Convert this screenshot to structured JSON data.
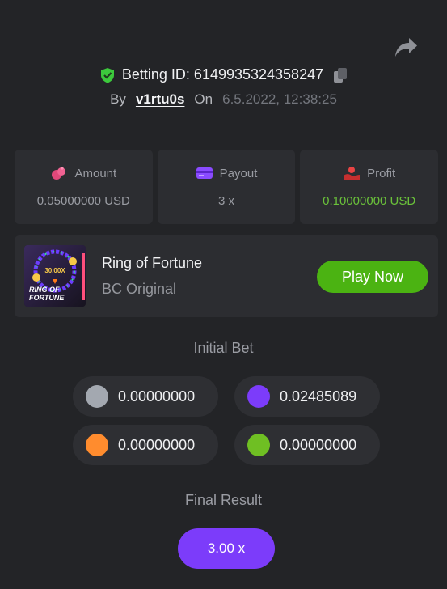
{
  "header": {
    "betting_id_label": "Betting ID: 6149935324358247",
    "by_label": "By",
    "username": "v1rtu0s",
    "on_label": "On",
    "date": "6.5.2022, 12:38:25"
  },
  "stats": {
    "amount": {
      "label": "Amount",
      "value": "0.05000000 USD"
    },
    "payout": {
      "label": "Payout",
      "value": "3 x"
    },
    "profit": {
      "label": "Profit",
      "value": "0.10000000 USD"
    }
  },
  "game": {
    "name": "Ring of Fortune",
    "subtitle": "BC Original",
    "play_label": "Play Now",
    "thumb_multiplier": "30.00X",
    "thumb_logo_line1": "RING OF",
    "thumb_logo_line2": "FORTUNE"
  },
  "initial_bet": {
    "title": "Initial Bet",
    "chips": [
      {
        "color": "#a3a8b0",
        "value": "0.00000000"
      },
      {
        "color": "#7c3cfa",
        "value": "0.02485089"
      },
      {
        "color": "#ff8c2e",
        "value": "0.00000000"
      },
      {
        "color": "#6fbf23",
        "value": "0.00000000"
      }
    ]
  },
  "final_result": {
    "title": "Final Result",
    "value": "3.00 x"
  },
  "colors": {
    "background": "#232427",
    "panel": "#2c2d31",
    "green": "#4bb312",
    "purple": "#7c3cfa",
    "profit": "#6ac13a"
  },
  "icons": [
    "share-icon",
    "shield-check-icon",
    "copy-icon",
    "amount-icon",
    "payout-card-icon",
    "profit-icon"
  ]
}
